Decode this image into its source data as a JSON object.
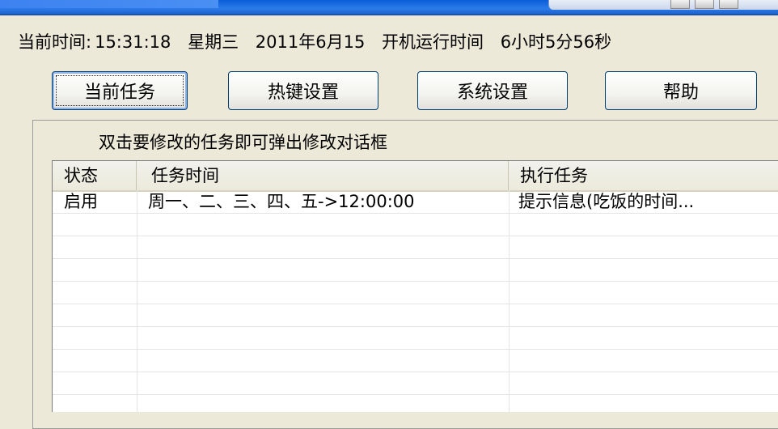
{
  "status_line": {
    "time_label": "当前时间:",
    "time_value": "15:31:18",
    "weekday": "星期三",
    "date": "2011年6月15",
    "uptime_label": "开机运行时间",
    "uptime_value": "6小时5分56秒"
  },
  "toolbar": {
    "current_tasks": "当前任务",
    "hotkey_settings": "热键设置",
    "system_settings": "系统设置",
    "help": "帮助"
  },
  "task_panel": {
    "hint": "双击要修改的任务即可弹出修改对话框",
    "columns": [
      "状态",
      "任务时间",
      "执行任务"
    ],
    "rows": [
      [
        "启用",
        "周一、二、三、四、五->12:00:00",
        "提示信息(吃饭的时间..."
      ]
    ]
  }
}
